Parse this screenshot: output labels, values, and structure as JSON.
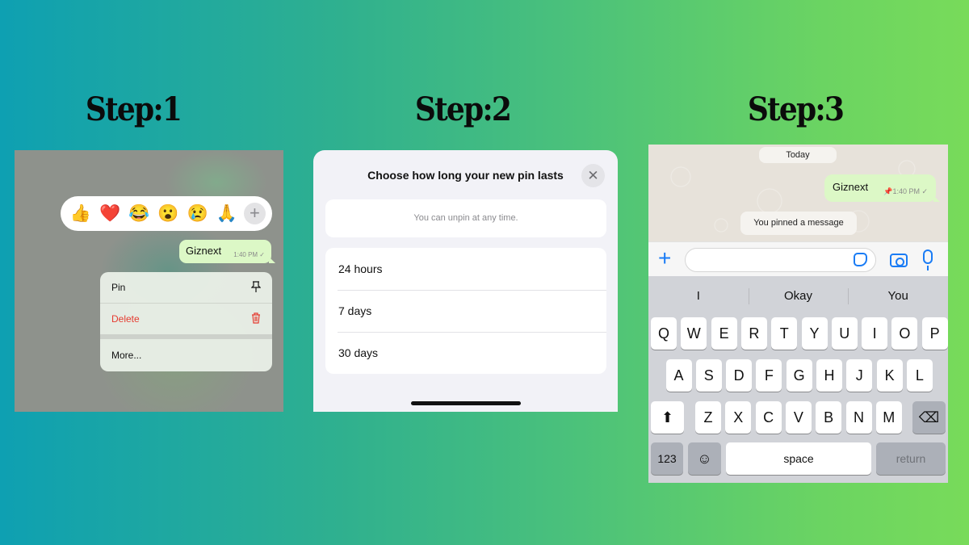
{
  "steps": [
    {
      "title": "Step:1"
    },
    {
      "title": "Step:2"
    },
    {
      "title": "Step:3"
    }
  ],
  "panel1": {
    "reactions": [
      "👍",
      "❤️",
      "😂",
      "😮",
      "😢",
      "🙏"
    ],
    "reaction_more": "+",
    "message": {
      "text": "Giznext",
      "time": "1:40 PM ✓"
    },
    "menu": [
      {
        "label": "Pin",
        "icon": "⚲",
        "icon_name": "pin-icon",
        "destructive": false
      },
      {
        "label": "Delete",
        "icon": "🗑",
        "icon_name": "trash-icon",
        "destructive": true
      },
      {
        "label": "More...",
        "icon": "",
        "icon_name": "",
        "destructive": false
      }
    ],
    "colors": {
      "destructive": "#e53b30",
      "bubble": "#dcf8c6"
    }
  },
  "panel2": {
    "title": "Choose how long your new pin lasts",
    "close": "✕",
    "info": "You can unpin at any time.",
    "options": [
      "24 hours",
      "7 days",
      "30 days"
    ]
  },
  "panel3": {
    "date": "Today",
    "message": {
      "text": "Giznext",
      "time": "📌1:40 PM ✓"
    },
    "system_message": "You pinned a message",
    "input_placeholder": "",
    "suggestions": [
      "I",
      "Okay",
      "You"
    ],
    "keyboard": {
      "row1": [
        "Q",
        "W",
        "E",
        "R",
        "T",
        "Y",
        "U",
        "I",
        "O",
        "P"
      ],
      "row2": [
        "A",
        "S",
        "D",
        "F",
        "G",
        "H",
        "J",
        "K",
        "L"
      ],
      "row3": [
        "Z",
        "X",
        "C",
        "V",
        "B",
        "N",
        "M"
      ],
      "shift": "⬆",
      "backspace": "⌫",
      "numbers": "123",
      "emoji": "☺",
      "space": "space",
      "return": "return"
    },
    "accent": "#1a7cf5"
  }
}
